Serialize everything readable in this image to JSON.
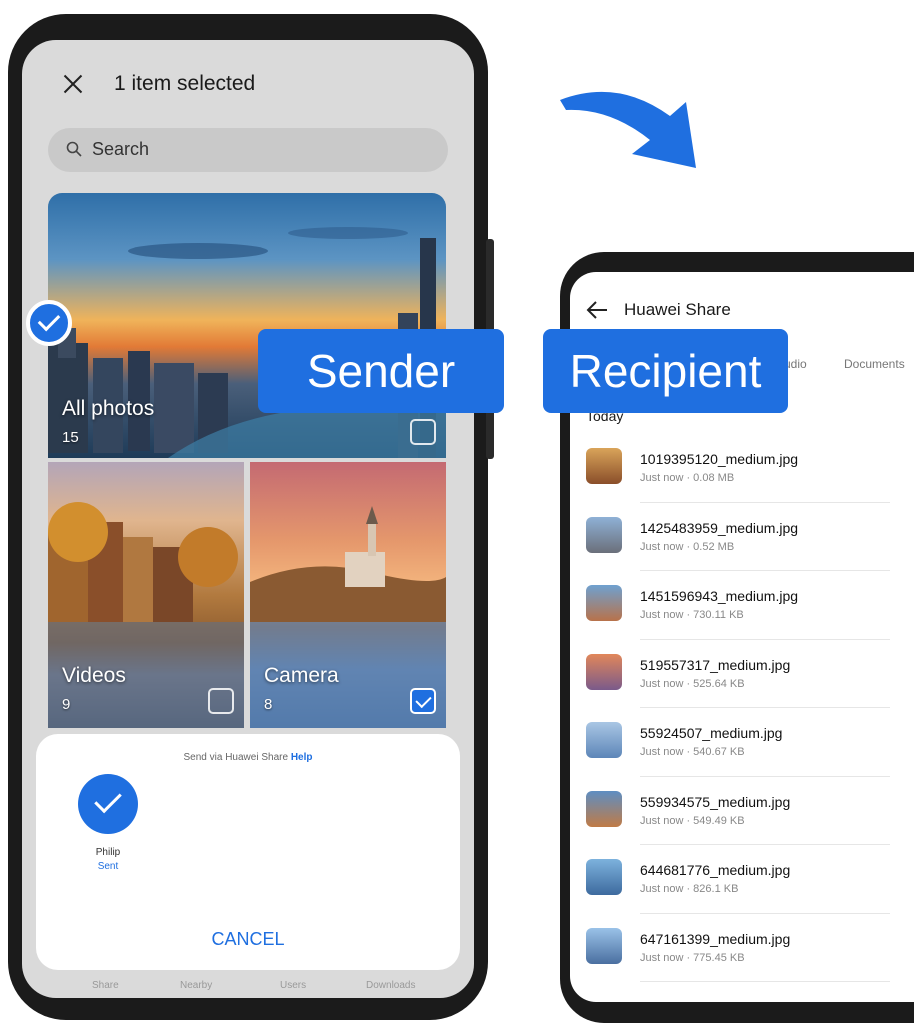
{
  "sender": {
    "header": {
      "title": "1 item selected"
    },
    "search": {
      "placeholder": "Search"
    },
    "albums": [
      {
        "label": "All photos",
        "count": "15",
        "checked": false
      },
      {
        "label": "Videos",
        "count": "9",
        "checked": false
      },
      {
        "label": "Camera",
        "count": "8",
        "checked": true
      }
    ],
    "share_sheet": {
      "title": "Send via Huawei Share",
      "help": "Help",
      "device": {
        "name": "Philip",
        "status": "Sent"
      },
      "cancel": "CANCEL"
    },
    "bottom_nav": [
      "Share",
      "Nearby",
      "Users",
      "Downloads"
    ]
  },
  "recipient": {
    "header": {
      "title": "Huawei Share"
    },
    "tabs": [
      "Audio",
      "Documents"
    ],
    "section": "Today",
    "files": [
      {
        "name": "1019395120_medium.jpg",
        "meta": "Just now · 0.08 MB",
        "thumb": [
          "#d9a45a",
          "#8a4e2a"
        ]
      },
      {
        "name": "1425483959_medium.jpg",
        "meta": "Just now · 0.52 MB",
        "thumb": [
          "#8fb1d6",
          "#6b6f7a"
        ]
      },
      {
        "name": "1451596943_medium.jpg",
        "meta": "Just now · 730.11 KB",
        "thumb": [
          "#6fa1d0",
          "#b8724a"
        ]
      },
      {
        "name": "519557317_medium.jpg",
        "meta": "Just now · 525.64 KB",
        "thumb": [
          "#e1875a",
          "#7a5a8a"
        ]
      },
      {
        "name": "55924507_medium.jpg",
        "meta": "Just now · 540.67 KB",
        "thumb": [
          "#a9c6e4",
          "#5d86b8"
        ]
      },
      {
        "name": "559934575_medium.jpg",
        "meta": "Just now · 549.49 KB",
        "thumb": [
          "#5e8ec2",
          "#c07b46"
        ]
      },
      {
        "name": "644681776_medium.jpg",
        "meta": "Just now · 826.1 KB",
        "thumb": [
          "#7db2dd",
          "#3d6a9e"
        ]
      },
      {
        "name": "647161399_medium.jpg",
        "meta": "Just now · 775.45 KB",
        "thumb": [
          "#9ac2e8",
          "#4a6fa0"
        ]
      }
    ]
  },
  "labels": {
    "sender": "Sender",
    "recipient": "Recipient"
  },
  "colors": {
    "accent": "#1f6fe0",
    "frame": "#1b1b1b"
  }
}
